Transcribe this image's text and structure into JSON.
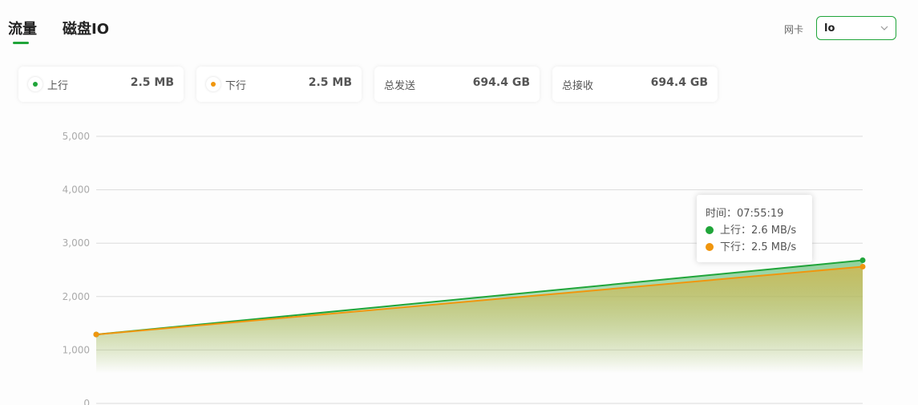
{
  "tabs": [
    {
      "label": "流量",
      "active": true
    },
    {
      "label": "磁盘IO",
      "active": false
    }
  ],
  "nic": {
    "label": "网卡",
    "selected": "lo",
    "icon": "chevron-down-icon"
  },
  "stats": [
    {
      "label": "上行",
      "value": "2.5 MB",
      "color": "#20a53a",
      "has_dot": true
    },
    {
      "label": "下行",
      "value": "2.5 MB",
      "color": "#f0960e",
      "has_dot": true
    },
    {
      "label": "总发送",
      "value": "694.4 GB",
      "has_dot": false
    },
    {
      "label": "总接收",
      "value": "694.4 GB",
      "has_dot": false
    }
  ],
  "tooltip": {
    "time": "时间：07:55:19",
    "up": "上行：2.6 MB/s",
    "down": "下行：2.5 MB/s"
  },
  "colors": {
    "accent": "#20a53a",
    "up": "#20a53a",
    "down": "#f0960e",
    "area": "#c8bb5c"
  },
  "chart_data": {
    "type": "area",
    "y_ticks": [
      "5,000",
      "4,000",
      "3,000",
      "2,000",
      "1,000",
      "0"
    ],
    "ylim": [
      0,
      5000
    ],
    "grid": true,
    "series": [
      {
        "name": "上行",
        "values": [
          1290,
          2680
        ],
        "color": "#20a53a"
      },
      {
        "name": "下行",
        "values": [
          1290,
          2560
        ],
        "color": "#f0960e"
      }
    ]
  }
}
